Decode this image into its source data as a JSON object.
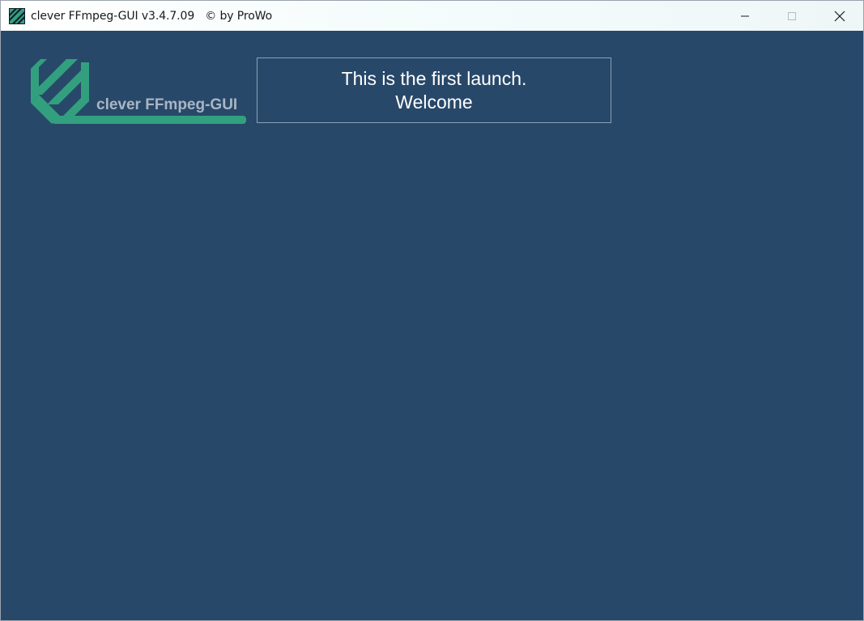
{
  "window": {
    "title": "clever FFmpeg-GUI v3.4.7.09   © by ProWo",
    "controls": {
      "minimize": "minimize-icon",
      "maximize": "maximize-icon",
      "close": "close-icon"
    }
  },
  "logo": {
    "text": "clever FFmpeg-GUI",
    "icon": "ffmpeg-logo-icon"
  },
  "welcome": {
    "line1": "This is the first launch.",
    "line2": "Welcome"
  },
  "colors": {
    "background": "#284869",
    "logo_green": "#32a07e",
    "logo_text": "#a9b6c3",
    "box_border": "#8aa0b6"
  }
}
